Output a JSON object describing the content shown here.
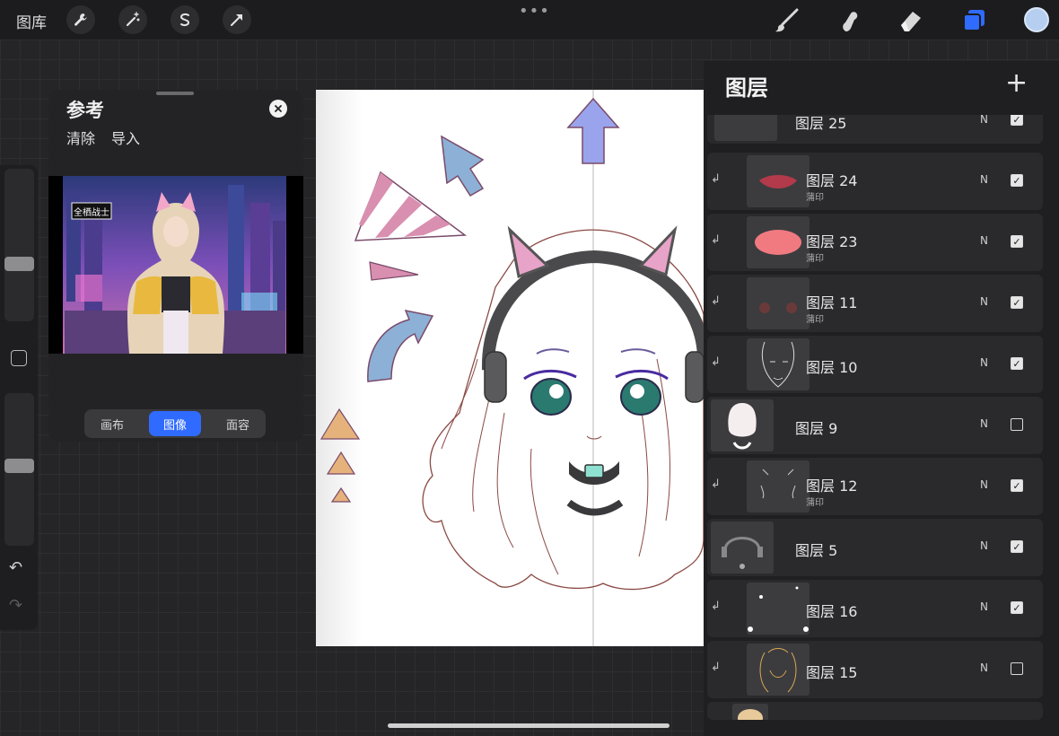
{
  "topbar": {
    "gallery_label": "图库",
    "left_tools": [
      "wrench-icon",
      "magic-wand-icon",
      "selection-icon",
      "transform-arrow-icon"
    ],
    "right_tools": [
      "brush-icon",
      "smudge-icon",
      "eraser-icon",
      "layers-icon"
    ],
    "menu_dots": "•••",
    "current_color": "#b6cff0",
    "accent": "#2f6bff"
  },
  "sidebar": {
    "undo": "↶",
    "redo": "↷"
  },
  "reference": {
    "title": "参考",
    "clear": "清除",
    "import": "导入",
    "segments": [
      "画布",
      "图像",
      "面容"
    ],
    "active_segment": "图像",
    "image_text": "全栖战士"
  },
  "layers_panel": {
    "title": "图层",
    "add": "+",
    "rows": [
      {
        "name": "图层 25",
        "sub": "",
        "blend": "N",
        "visible": true,
        "clipped": false
      },
      {
        "name": "图层 24",
        "sub": "蒲印",
        "blend": "N",
        "visible": true,
        "clipped": true
      },
      {
        "name": "图层 23",
        "sub": "蒲印",
        "blend": "N",
        "visible": true,
        "clipped": true
      },
      {
        "name": "图层 11",
        "sub": "蒲印",
        "blend": "N",
        "visible": true,
        "clipped": true
      },
      {
        "name": "图层 10",
        "sub": "",
        "blend": "N",
        "visible": true,
        "clipped": true
      },
      {
        "name": "图层 9",
        "sub": "",
        "blend": "N",
        "visible": false,
        "clipped": false
      },
      {
        "name": "图层 12",
        "sub": "蒲印",
        "blend": "N",
        "visible": true,
        "clipped": true
      },
      {
        "name": "图层 5",
        "sub": "",
        "blend": "N",
        "visible": true,
        "clipped": false
      },
      {
        "name": "图层 16",
        "sub": "",
        "blend": "N",
        "visible": true,
        "clipped": true
      },
      {
        "name": "图层 15",
        "sub": "",
        "blend": "N",
        "visible": false,
        "clipped": true
      }
    ]
  }
}
